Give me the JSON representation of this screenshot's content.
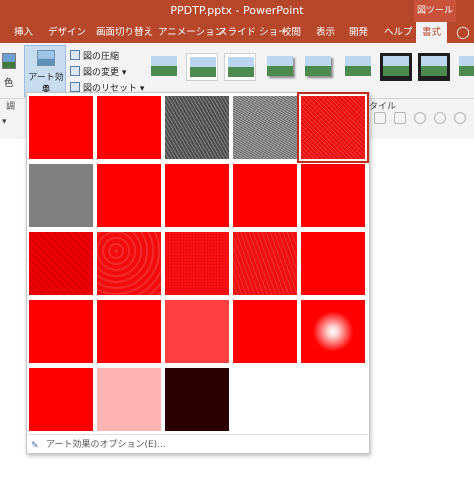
{
  "window": {
    "title": "PPDTP.pptx  -  PowerPoint",
    "tool_group": "図ツール"
  },
  "tabs": [
    {
      "label": "挿入"
    },
    {
      "label": "デザイン"
    },
    {
      "label": "画面切り替え"
    },
    {
      "label": "アニメーション"
    },
    {
      "label": "スライド ショー"
    },
    {
      "label": "校閲"
    },
    {
      "label": "表示"
    },
    {
      "label": "開発"
    },
    {
      "label": "ヘルプ"
    },
    {
      "label": "書式",
      "active": true
    }
  ],
  "ribbon": {
    "color_label": "色",
    "art_effects_label": "アート効果",
    "compress_label": "図の圧縮",
    "change_label": "図の変更",
    "reset_label": "図のリセット",
    "styles_group_label": "スタイル"
  },
  "left_strip": {
    "label": "調",
    "marker": "▾"
  },
  "effects": [
    {
      "color": "#ff0000",
      "texture": "none"
    },
    {
      "color": "#ff0000",
      "texture": "none"
    },
    {
      "color": "#5a5a5a",
      "texture": "pencil-grayscale"
    },
    {
      "color": "#7a7a7a",
      "texture": "pencil-sketch"
    },
    {
      "color": "#ef1010",
      "texture": "line-drawing",
      "selected": true
    },
    {
      "color": "#808080",
      "texture": "none"
    },
    {
      "color": "#ff0000",
      "texture": "none"
    },
    {
      "color": "#ff0000",
      "texture": "none"
    },
    {
      "color": "#ff0000",
      "texture": "none"
    },
    {
      "color": "#ff0000",
      "texture": "none"
    },
    {
      "color": "#ee0000",
      "texture": "paint-strokes"
    },
    {
      "color": "#f20c0c",
      "texture": "plastic-wrap"
    },
    {
      "color": "#ff1010",
      "texture": "texturizer"
    },
    {
      "color": "#ee1010",
      "texture": "chalk"
    },
    {
      "color": "#ff0000",
      "texture": "none"
    },
    {
      "color": "#ff0000",
      "texture": "none"
    },
    {
      "color": "#ff0000",
      "texture": "none"
    },
    {
      "color": "#ff4040",
      "texture": "none"
    },
    {
      "color": "#ff0000",
      "texture": "none"
    },
    {
      "color": "#ff0000",
      "texture": "glow-edges"
    },
    {
      "color": "#ff0000",
      "texture": "none"
    },
    {
      "color": "#ffb3b3",
      "texture": "none"
    },
    {
      "color": "#2a0000",
      "texture": "none"
    }
  ],
  "footer": {
    "label": "アート効果のオプション(E)..."
  }
}
